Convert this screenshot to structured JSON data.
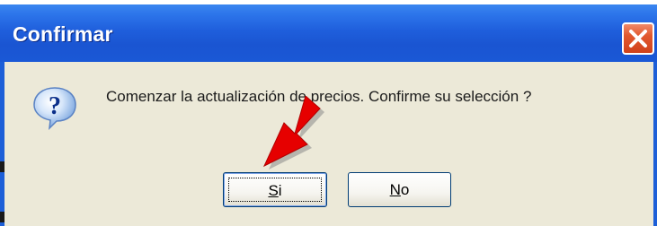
{
  "dialog": {
    "title": "Confirmar",
    "message": "Comenzar la actualización de precios. Confirme su selección ?",
    "icon": "question-icon",
    "close_icon": "close-icon",
    "buttons": {
      "yes": {
        "mnemonic": "S",
        "rest": "i",
        "full": "Si"
      },
      "no": {
        "mnemonic": "N",
        "rest": "o",
        "full": "No"
      }
    }
  },
  "annotation": {
    "arrow_icon": "red-arrow-icon",
    "arrow_color": "#e60000"
  },
  "colors": {
    "titlebar": "#1f5fdc",
    "client": "#ece9d8",
    "close_button": "#e2582e"
  }
}
